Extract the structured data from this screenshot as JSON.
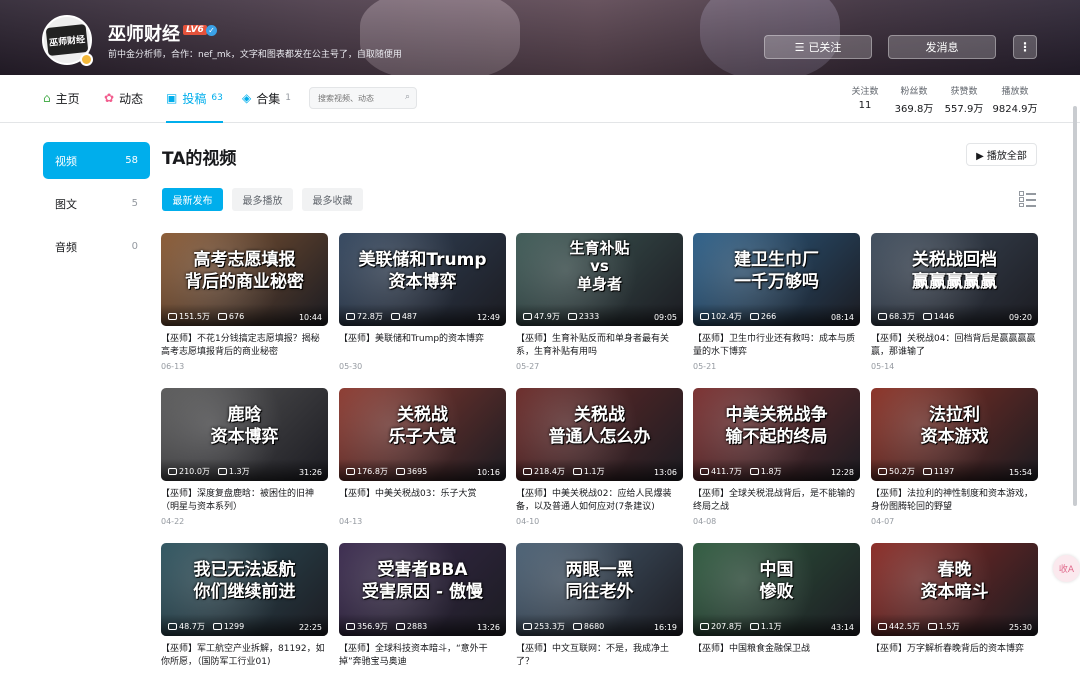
{
  "header": {
    "username": "巫师财经",
    "level": "LV6",
    "bio": "前中金分析师，合作：nef_mk，文字和图表都发在公主号了，自取随便用",
    "avatar_text": "巫师财经",
    "follow_label": "已关注",
    "message_label": "发消息",
    "more_label": "⋮"
  },
  "nav": {
    "home": "主页",
    "dynamic": "动态",
    "posts": "投稿",
    "posts_count": "63",
    "collections": "合集",
    "collections_count": "1",
    "search_placeholder": "搜索视频、动态"
  },
  "stats": [
    {
      "label": "关注数",
      "value": "11"
    },
    {
      "label": "粉丝数",
      "value": "369.8万"
    },
    {
      "label": "获赞数",
      "value": "557.9万"
    },
    {
      "label": "播放数",
      "value": "9824.9万"
    }
  ],
  "sidebar": {
    "items": [
      {
        "label": "视频",
        "count": "58"
      },
      {
        "label": "图文",
        "count": "5"
      },
      {
        "label": "音频",
        "count": "0"
      }
    ]
  },
  "main": {
    "title": "TA的视频",
    "play_all": "▶ 播放全部",
    "sort": [
      "最新发布",
      "最多播放",
      "最多收藏"
    ]
  },
  "videos": [
    {
      "thumb_text": "高考志愿填报\n背后的商业秘密",
      "views": "151.5万",
      "danmaku": "676",
      "duration": "10:44",
      "title": "【巫师】不花1分钱搞定志愿填报？揭秘高考志愿填报背后的商业秘密",
      "date": "06-13",
      "color": "#8a5a34"
    },
    {
      "thumb_text": "美联储和Trump\n资本博弈",
      "views": "72.8万",
      "danmaku": "487",
      "duration": "12:49",
      "title": "【巫师】美联储和Trump的资本博弈",
      "date": "05-30",
      "color": "#33465e"
    },
    {
      "thumb_text": "生育补贴\nvs\n单身者",
      "views": "47.9万",
      "danmaku": "2333",
      "duration": "09:05",
      "title": "【巫师】生育补贴反而和单身者最有关系，生育补贴有用吗",
      "date": "05-27",
      "color": "#3e5a56"
    },
    {
      "thumb_text": "建卫生巾厂\n一千万够吗",
      "views": "102.4万",
      "danmaku": "266",
      "duration": "08:14",
      "title": "【巫师】卫生巾行业还有救吗：成本与质量的水下博弈",
      "date": "05-21",
      "color": "#2c5f88"
    },
    {
      "thumb_text": "关税战回档\n赢赢赢赢赢",
      "views": "68.3万",
      "danmaku": "1446",
      "duration": "09:20",
      "title": "【巫师】关税战04：回档背后是赢赢赢赢赢，那谁输了",
      "date": "05-14",
      "color": "#3e4c5c"
    },
    {
      "thumb_text": "鹿晗\n资本博弈",
      "views": "210.0万",
      "danmaku": "1.3万",
      "duration": "31:26",
      "title": "【巫师】深度复盘鹿晗：被困住的旧神（明星与资本系列）",
      "date": "04-22",
      "color": "#5a5a5a"
    },
    {
      "thumb_text": "关税战\n乐子大赏",
      "views": "176.8万",
      "danmaku": "3695",
      "duration": "10:16",
      "title": "【巫师】中美关税战03：乐子大赏",
      "date": "04-13",
      "color": "#8c3a30"
    },
    {
      "thumb_text": "关税战\n普通人怎么办",
      "views": "218.4万",
      "danmaku": "1.1万",
      "duration": "13:06",
      "title": "【巫师】中美关税战02：应给人民爆装备，以及普通人如何应对(7条建议)",
      "date": "04-10",
      "color": "#6a2a28"
    },
    {
      "thumb_text": "中美关税战争\n输不起的终局",
      "views": "411.7万",
      "danmaku": "1.8万",
      "duration": "12:28",
      "title": "【巫师】全球关税混战背后，是不能输的终局之战",
      "date": "04-08",
      "color": "#7a2f2f"
    },
    {
      "thumb_text": "法拉利\n资本游戏",
      "views": "50.2万",
      "danmaku": "1197",
      "duration": "15:54",
      "title": "【巫师】法拉利的神性制度和资本游戏，身份图腾轮回的野望",
      "date": "04-07",
      "color": "#8a3024"
    },
    {
      "thumb_text": "我已无法返航\n你们继续前进",
      "views": "48.7万",
      "danmaku": "1299",
      "duration": "22:25",
      "title": "【巫师】军工航空产业拆解，81192，如你所愿，（国防军工行业01)",
      "date": "",
      "color": "#2f5560"
    },
    {
      "thumb_text": "受害者BBA\n受害原因 - 傲慢",
      "views": "356.9万",
      "danmaku": "2883",
      "duration": "13:26",
      "title": "【巫师】全球科技资本暗斗，“意外干掉”奔驰宝马奥迪",
      "date": "",
      "color": "#3a2a4e"
    },
    {
      "thumb_text": "两眼一黑\n同往老外",
      "views": "253.3万",
      "danmaku": "8680",
      "duration": "16:19",
      "title": "【巫师】中文互联网：不是，我成净土了？",
      "date": "",
      "color": "#4a6074"
    },
    {
      "thumb_text": "中国\n惨败",
      "views": "207.8万",
      "danmaku": "1.1万",
      "duration": "43:14",
      "title": "【巫师】中国粮食金融保卫战",
      "date": "",
      "color": "#2e5a3e"
    },
    {
      "thumb_text": "春晚\n资本暗斗",
      "views": "442.5万",
      "danmaku": "1.5万",
      "duration": "25:30",
      "title": "【巫师】万字解析春晚背后的资本博弈",
      "date": "",
      "color": "#8a2a24"
    }
  ],
  "float_button": "收A"
}
